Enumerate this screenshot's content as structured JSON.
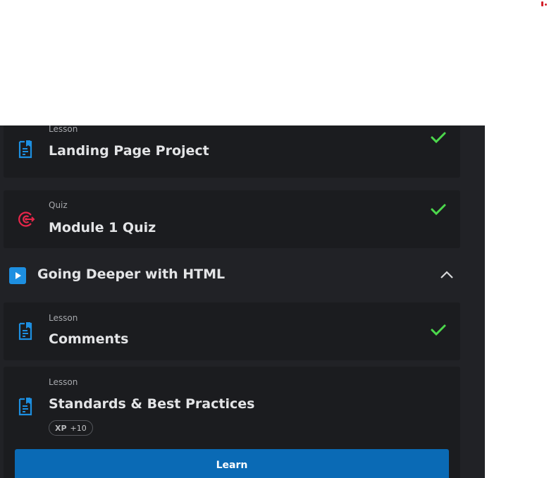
{
  "lessons": [
    {
      "type": "Lesson",
      "title": "Landing Page Project",
      "completed": true,
      "icon": "lesson-document-icon"
    },
    {
      "type": "Quiz",
      "title": "Module 1 Quiz",
      "completed": true,
      "icon": "quiz-target-icon"
    }
  ],
  "section": {
    "title": "Going Deeper with HTML",
    "expanded": true,
    "icon": "play-icon"
  },
  "section_lessons": [
    {
      "type": "Lesson",
      "title": "Comments",
      "completed": true,
      "icon": "lesson-document-icon"
    },
    {
      "type": "Lesson",
      "title": "Standards & Best Practices",
      "completed": false,
      "icon": "lesson-document-icon",
      "xp_label": "XP",
      "xp_value": "+10",
      "action_label": "Learn"
    }
  ],
  "colors": {
    "accent_blue": "#1d8fe1",
    "check_green": "#4cd84c",
    "quiz_red": "#e8264a",
    "button_blue": "#0a6ab5"
  }
}
